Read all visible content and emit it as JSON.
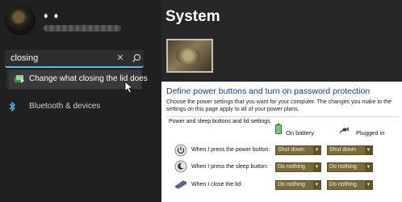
{
  "settings": {
    "user_name": "♦ ♦",
    "page_title": "System",
    "search": {
      "value": "closing",
      "clear_glyph": "✕"
    },
    "search_result": {
      "label": "Change what closing the lid does"
    },
    "nav_items": [
      {
        "label": "Bluetooth & devices"
      }
    ]
  },
  "dialog": {
    "title": "Define power buttons and turn on password protection",
    "description": "Choose the power settings that you want for your computer. The changes you make to the settings on this page apply to all of your power plans.",
    "section_title": "Power and sleep buttons and lid settings",
    "columns": {
      "battery": "On battery",
      "plugged": "Plugged in"
    },
    "rows": [
      {
        "label": "When I press the power button:",
        "battery": "Shut down",
        "plugged": "Shut down"
      },
      {
        "label": "When I press the sleep button:",
        "battery": "Do nothing",
        "plugged": "Do nothing"
      },
      {
        "label": "When I close the lid:",
        "battery": "Do nothing",
        "plugged": "Do nothing"
      }
    ]
  },
  "colors": {
    "accent": "#4cc2ff",
    "dialog_title": "#1e3a8a",
    "select_bg": "#7a6b3a"
  }
}
